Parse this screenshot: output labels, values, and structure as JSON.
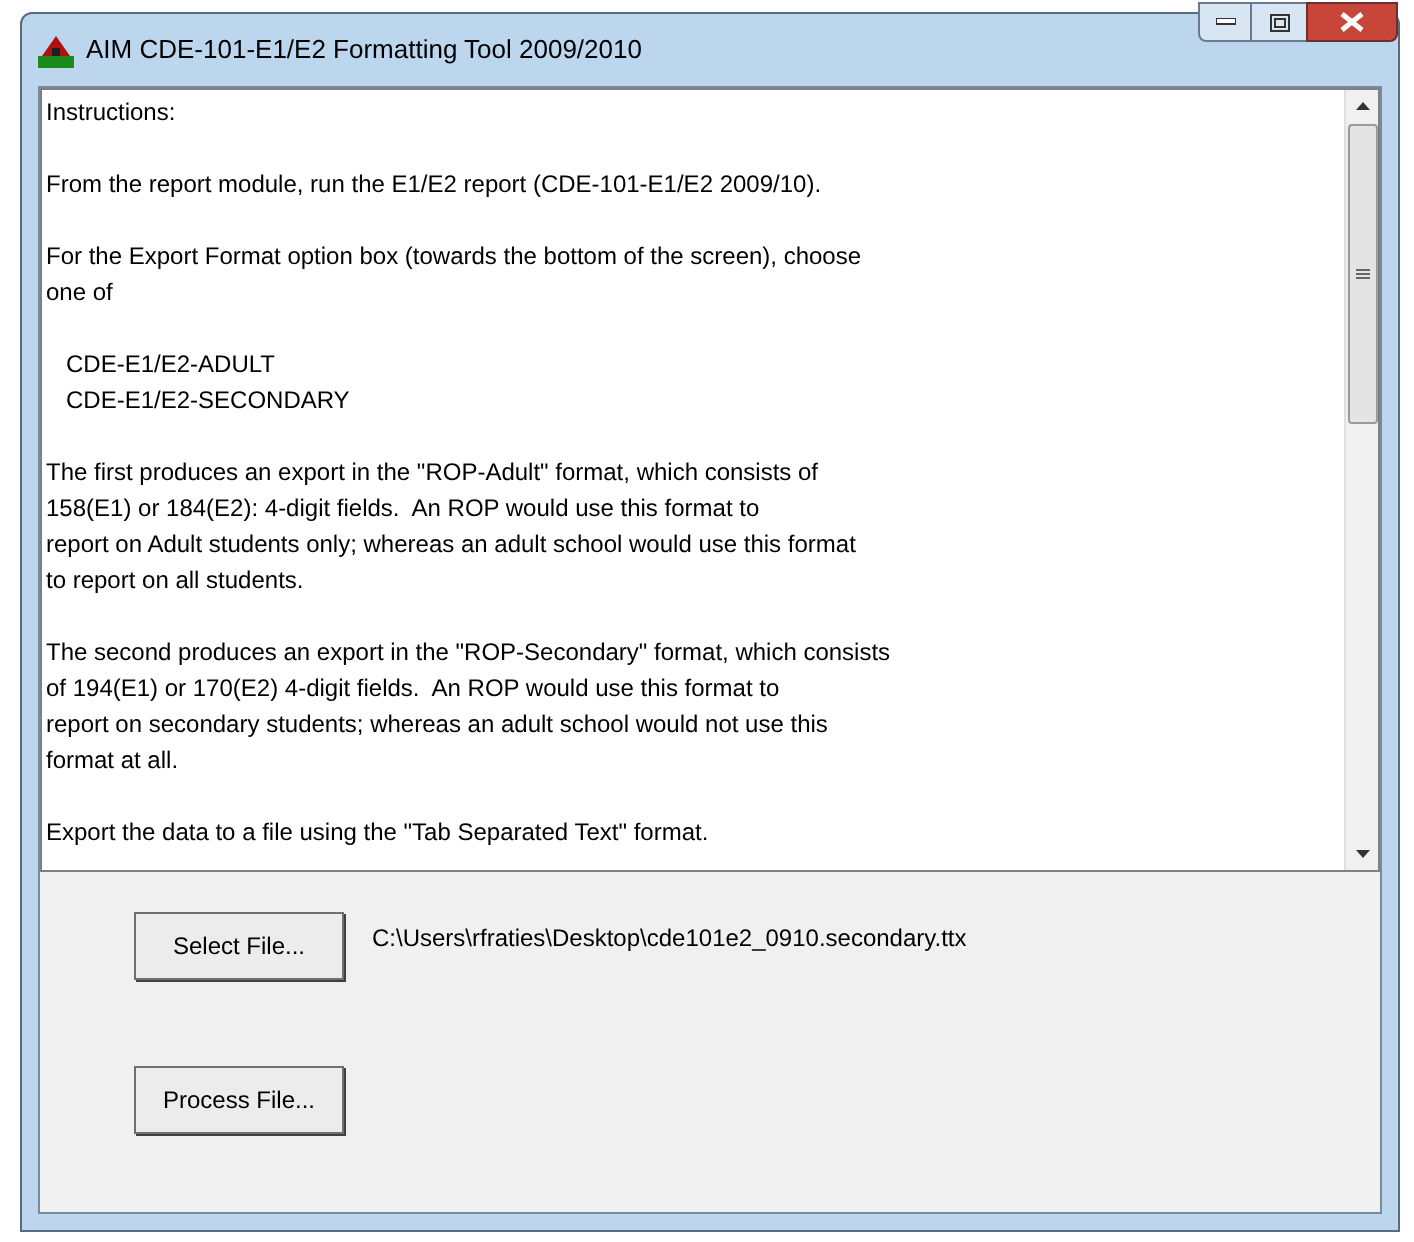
{
  "window": {
    "title": "AIM CDE-101-E1/E2 Formatting Tool 2009/2010"
  },
  "instructions": [
    {
      "kind": "text",
      "lines": [
        "Instructions:"
      ]
    },
    {
      "kind": "text",
      "lines": [
        "From the report module, run the E1/E2 report (CDE-101-E1/E2 2009/10)."
      ]
    },
    {
      "kind": "text",
      "lines": [
        "For the Export Format option box (towards the bottom of the screen), choose",
        "one of"
      ]
    },
    {
      "kind": "option",
      "lines": [
        "CDE-E1/E2-ADULT",
        "CDE-E1/E2-SECONDARY"
      ]
    },
    {
      "kind": "text",
      "lines": [
        "The first produces an export in the \"ROP-Adult\" format, which consists of",
        "158(E1) or 184(E2): 4-digit fields.  An ROP would use this format to",
        "report on Adult students only; whereas an adult school would use this format",
        "to report on all students."
      ]
    },
    {
      "kind": "text",
      "lines": [
        "The second produces an export in the \"ROP-Secondary\" format, which consists",
        "of 194(E1) or 170(E2) 4-digit fields.  An ROP would use this format to",
        "report on secondary students; whereas an adult school would not use this",
        "format at all."
      ]
    },
    {
      "kind": "text",
      "lines": [
        "Export the data to a file using the \"Tab Separated Text\" format."
      ]
    }
  ],
  "select_button": "Select File...",
  "file_path": "C:\\Users\\rfraties\\Desktop\\cde101e2_0910.secondary.ttx",
  "process_button": "Process File..."
}
